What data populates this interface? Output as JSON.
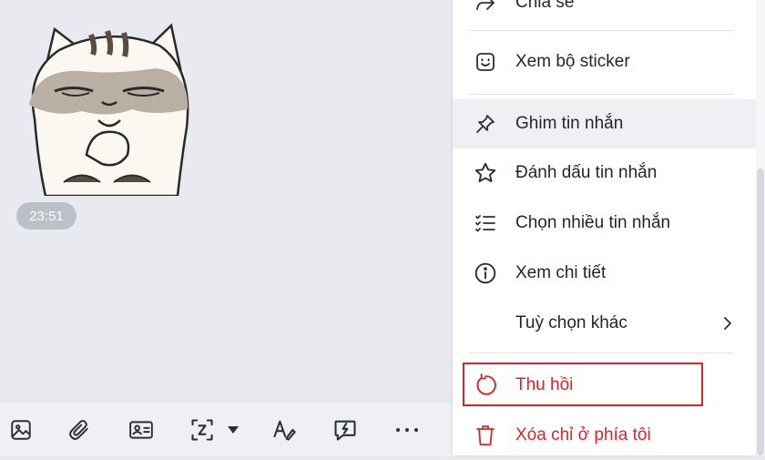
{
  "message": {
    "time": "23:51"
  },
  "toolbar": {
    "icons": [
      "image-icon",
      "attachment-icon",
      "contact-card-icon",
      "screenshot-icon",
      "text-format-icon",
      "quick-message-icon",
      "more-icon"
    ]
  },
  "context_menu": {
    "items": [
      {
        "label": "Chia sẻ",
        "icon": "share-icon"
      },
      {
        "label": "Xem bộ sticker",
        "icon": "sticker-icon"
      },
      {
        "label": "Ghim tin nhắn",
        "icon": "pin-icon"
      },
      {
        "label": "Đánh dấu tin nhắn",
        "icon": "star-icon"
      },
      {
        "label": "Chọn nhiều tin nhắn",
        "icon": "multi-select-icon"
      },
      {
        "label": "Xem chi tiết",
        "icon": "info-icon"
      },
      {
        "label": "Tuỳ chọn khác",
        "icon": "chevron-right-icon"
      },
      {
        "label": "Thu hồi",
        "icon": "recall-icon"
      },
      {
        "label": "Xóa chỉ ở phía tôi",
        "icon": "trash-icon"
      }
    ]
  },
  "colors": {
    "danger": "#d9262d",
    "background": "#e8eaef",
    "menu_bg": "#ffffff",
    "hover_bg": "#eef0f4"
  }
}
